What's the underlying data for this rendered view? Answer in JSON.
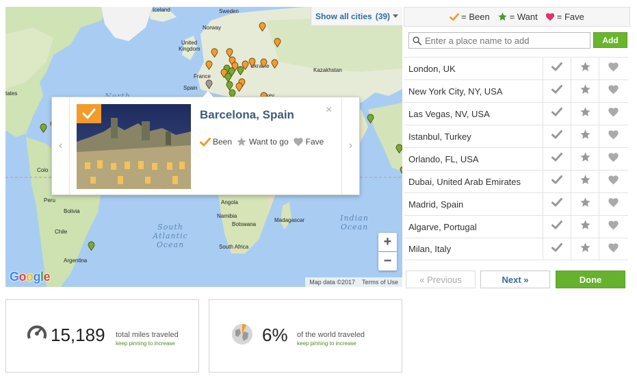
{
  "map": {
    "show_all_label": "Show all cities",
    "show_all_count": "(39)",
    "labels": {
      "iceland": "Iceland",
      "sweden": "Sweden",
      "norway": "Norway",
      "united_kingdom_1": "United",
      "united_kingdom_2": "Kingdom",
      "france": "France",
      "spain": "Spain",
      "ukraine": "Ukraine",
      "kazakhstan": "Kazakhstan",
      "turkey": "rkey",
      "states": "tates",
      "colombia": "Colo",
      "peru": "Peru",
      "bolivia": "Bolivia",
      "chile": "Chile",
      "argentina": "Argentina",
      "angola": "Angola",
      "namibia": "Namibia",
      "botswana": "Botswana",
      "south_africa": "South Africa",
      "madagascar": "Madagascar",
      "north": "North",
      "south_atlantic_1": "South",
      "south_atlantic_2": "Atlantic",
      "south_atlantic_3": "Ocean",
      "indian_1": "Indian",
      "indian_2": "Ocean"
    },
    "zoom_in": "+",
    "zoom_out": "−",
    "google_logo": [
      "G",
      "o",
      "o",
      "g",
      "l",
      "e"
    ],
    "logo_colors": [
      "#4285f4",
      "#ea4335",
      "#fbbc05",
      "#4285f4",
      "#34a853",
      "#ea4335"
    ],
    "attribution": "Map data ©2017",
    "terms": "Terms of Use"
  },
  "popup": {
    "title": "Barcelona, Spain",
    "close": "×",
    "prev": "‹",
    "next": "›",
    "been_label": "Been",
    "want_label": "Want to go",
    "fave_label": "Fave"
  },
  "legend": {
    "been": "= Been",
    "want": "= Want",
    "fave": "= Fave"
  },
  "colors": {
    "been": "#f39b2b",
    "want": "#4a9a2c",
    "fave": "#e0336a",
    "inactive": "#aaaaaa",
    "link": "#2d6ea3",
    "green_button": "#66b22e"
  },
  "search": {
    "placeholder": "Enter a place name to add",
    "add_label": "Add"
  },
  "places": [
    "London, UK",
    "New York City, NY, USA",
    "Las Vegas, NV, USA",
    "Istanbul, Turkey",
    "Orlando, FL, USA",
    "Dubai, United Arab Emirates",
    "Madrid, Spain",
    "Algarve, Portugal",
    "Milan, Italy"
  ],
  "pager": {
    "previous": "« Previous",
    "next": "Next »",
    "done": "Done"
  },
  "stats": {
    "miles_value": "15,189",
    "miles_label": "total miles traveled",
    "miles_sub": "keep pinning to increase",
    "world_value": "6%",
    "world_label": "of the world traveled",
    "world_sub": "keep pinning to increase"
  }
}
